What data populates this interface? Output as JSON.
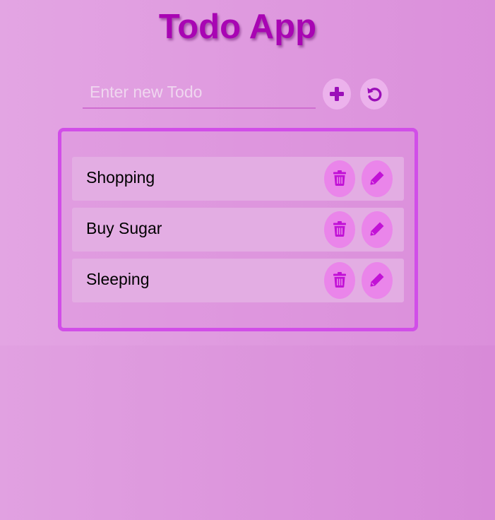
{
  "app": {
    "title": "Todo App"
  },
  "input": {
    "placeholder": "Enter new Todo",
    "value": ""
  },
  "actions": {
    "add_icon": "plus-icon",
    "reset_icon": "rotate-left-icon"
  },
  "todos": [
    {
      "text": "Shopping",
      "delete_icon": "trash-icon",
      "edit_icon": "pencil-icon"
    },
    {
      "text": "Buy Sugar",
      "delete_icon": "trash-icon",
      "edit_icon": "pencil-icon"
    },
    {
      "text": "Sleeping",
      "delete_icon": "trash-icon",
      "edit_icon": "pencil-icon"
    }
  ],
  "colors": {
    "title": "#a805b3",
    "accent": "#d14ee8",
    "icon_primary": "#9b0fb8",
    "icon_item": "#c212d6",
    "item_background": "#e3ade3",
    "item_button": "#ea85ea"
  }
}
